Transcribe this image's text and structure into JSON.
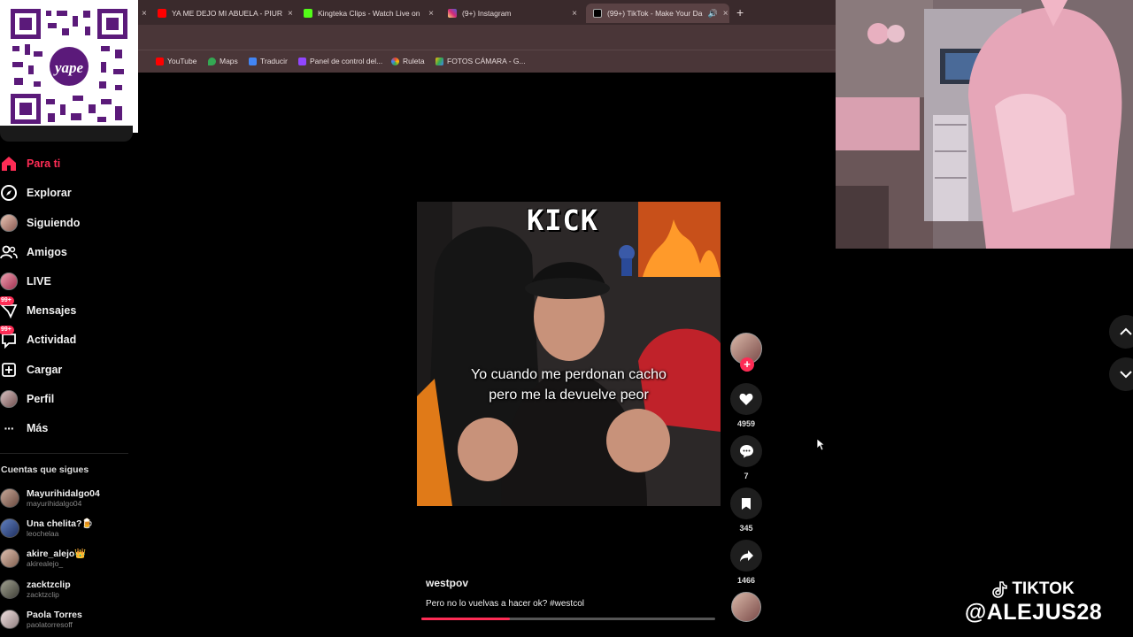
{
  "browser": {
    "tabs": [
      {
        "label": "YA ME DEJO MI ABUELA - PIUR",
        "icon": "youtube-icon",
        "color": "#ff0000"
      },
      {
        "label": "Kingteka Clips - Watch Live on",
        "icon": "kick-icon",
        "color": "#53fc18"
      },
      {
        "label": "(9+) Instagram",
        "icon": "instagram-icon",
        "color": "#d62976"
      },
      {
        "label": "(99+) TikTok - Make Your Da",
        "icon": "tiktok-icon",
        "color": "#ffffff"
      }
    ],
    "bookmarks": [
      {
        "label": "YouTube",
        "color": "#ff0000"
      },
      {
        "label": "Maps",
        "color": "#34a853"
      },
      {
        "label": "Traducir",
        "color": "#4285f4"
      },
      {
        "label": "Panel de control del...",
        "color": "#9146ff"
      },
      {
        "label": "Ruleta",
        "color": "#ea4335"
      },
      {
        "label": "FOTOS CÁMARA - G...",
        "color": "#fbbc05"
      }
    ]
  },
  "sidebar": {
    "nav": [
      {
        "label": "Para ti",
        "icon": "home-icon"
      },
      {
        "label": "Explorar",
        "icon": "compass-icon"
      },
      {
        "label": "Siguiendo",
        "icon": "avatar-icon"
      },
      {
        "label": "Amigos",
        "icon": "friends-icon"
      },
      {
        "label": "LIVE",
        "icon": "avatar-icon"
      },
      {
        "label": "Mensajes",
        "icon": "messages-icon",
        "badge": "99+"
      },
      {
        "label": "Actividad",
        "icon": "activity-icon",
        "badge": "99+"
      },
      {
        "label": "Cargar",
        "icon": "upload-icon"
      },
      {
        "label": "Perfil",
        "icon": "avatar-icon"
      },
      {
        "label": "Más",
        "icon": "more-icon"
      }
    ],
    "following_title": "Cuentas que sigues",
    "following": [
      {
        "name": "Mayurihidalgo04",
        "handle": "mayurihidalgo04"
      },
      {
        "name": "Una chelita?🍺",
        "handle": "leochelaa"
      },
      {
        "name": "akire_alejo👑",
        "handle": "akirealejo_"
      },
      {
        "name": "zacktzclip",
        "handle": "zacktzclip"
      },
      {
        "name": "Paola Torres",
        "handle": "paolatorresoff"
      }
    ]
  },
  "video": {
    "overlay_title": "KICK",
    "caption_line1": "Yo cuando me perdonan cacho",
    "caption_line2": "pero me la devuelve peor",
    "author": "westpov",
    "description": "Pero no lo vuelvas a hacer ok? #westcol",
    "progress": 0.3
  },
  "actions": {
    "likes": "4959",
    "comments": "7",
    "saves": "345",
    "shares": "1466"
  },
  "watermark": {
    "line1": "TIKTOK",
    "line2": "@ALEJUS28"
  },
  "colors": {
    "accent": "#fe2c55",
    "chrome": "#4a3638"
  }
}
